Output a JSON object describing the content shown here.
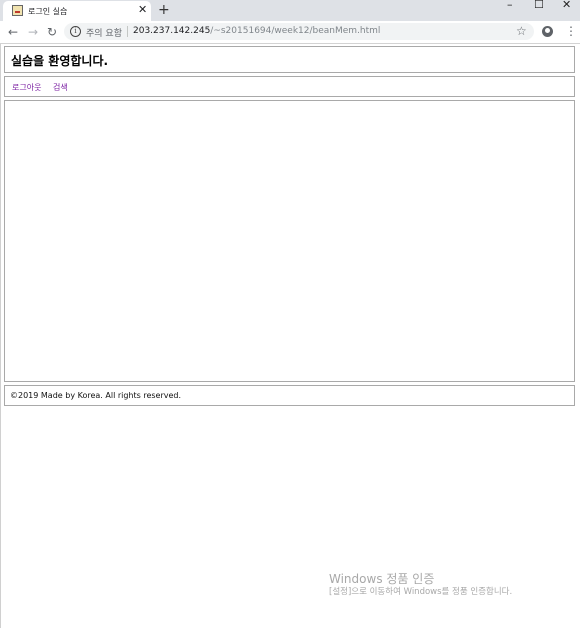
{
  "browser": {
    "tab": {
      "title": "로그인 실습",
      "close": "✕"
    },
    "new_tab": "+",
    "window_controls": {
      "minimize": "–",
      "maximize": "☐",
      "close": "✕"
    },
    "nav": {
      "back": "←",
      "forward": "→",
      "reload": "↻"
    },
    "omnibox": {
      "security_icon": "i",
      "security_text": "주의 요함",
      "url_host": "203.237.142.245",
      "url_path": "/~s20151694/week12/beanMem.html"
    },
    "star": "☆",
    "menu": "⋮"
  },
  "page": {
    "title": "실습을 환영합니다.",
    "nav": {
      "logout": "로그아웃",
      "search": "검색"
    },
    "footer": "©2019 Made by Korea. All rights reserved."
  },
  "watermark": {
    "title": "Windows 정품 인증",
    "subtitle": "[설정]으로 이동하여 Windows를 정품 인증합니다."
  },
  "colors": {
    "link": "#7b1fa2",
    "border": "#a9a9a9",
    "tabstrip": "#dee1e6"
  }
}
